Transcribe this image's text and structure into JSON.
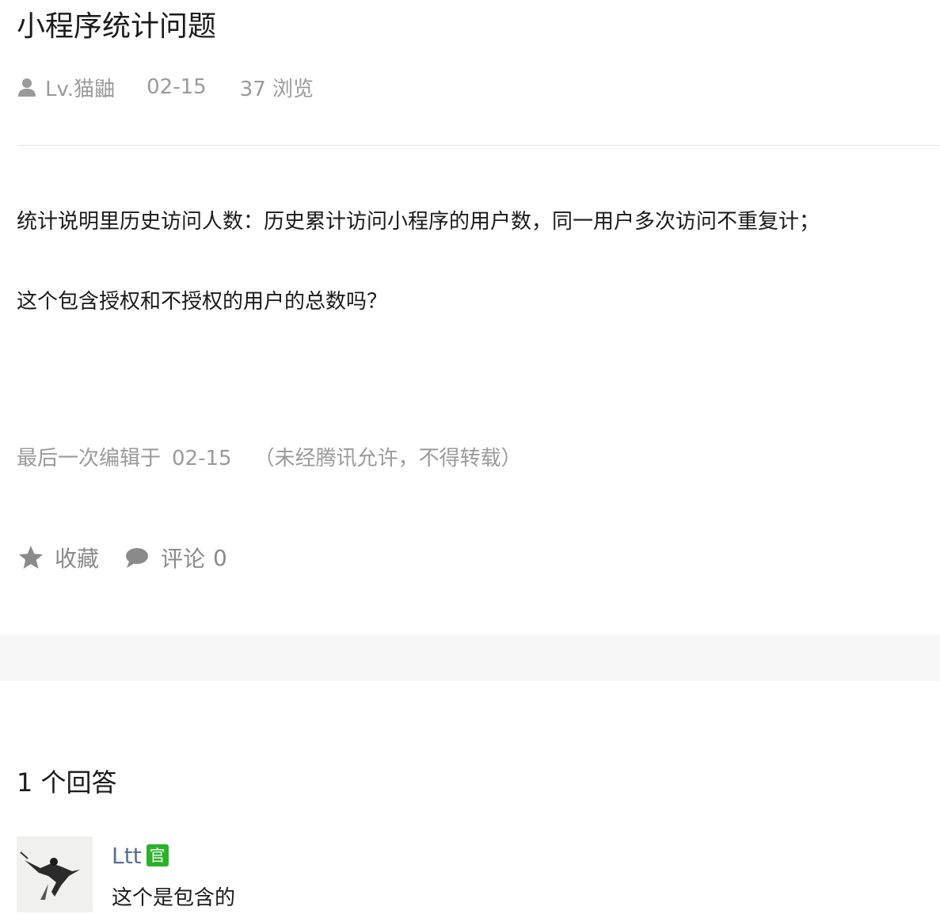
{
  "post": {
    "title": "小程序统计问题",
    "author": "Lv.猫鼬",
    "date": "02-15",
    "views": "37 浏览",
    "paragraphs": [
      "统计说明里历史访问人数：历史累计访问小程序的用户数，同一用户多次访问不重复计；",
      "这个包含授权和不授权的用户的总数吗？"
    ],
    "edit_prefix": "最后一次编辑于",
    "edit_date": "02-15",
    "edit_note": "（未经腾讯允许，不得转载）"
  },
  "actions": {
    "favorite_label": "收藏",
    "comment_label": "评论",
    "comment_count": "0"
  },
  "answers": {
    "heading": "1 个回答",
    "items": [
      {
        "name": "Ltt",
        "badge": "官",
        "text": "这个是包含的"
      }
    ]
  },
  "icons": {
    "author": "user-icon",
    "favorite": "star-icon",
    "comment": "speech-bubble-icon"
  },
  "colors": {
    "muted": "#9a9a9a",
    "link": "#5a6e8f",
    "badge": "#2ab02a",
    "band": "#f7f7f8"
  }
}
